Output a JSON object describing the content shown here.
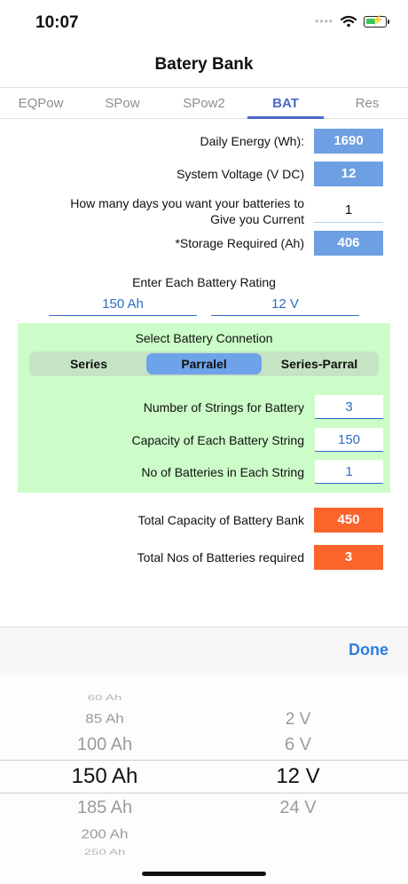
{
  "status": {
    "time": "10:07",
    "battery_level": 0.55,
    "signal_dots": "••••"
  },
  "nav": {
    "title": "Batery Bank"
  },
  "tabs": [
    {
      "label": "EQPow"
    },
    {
      "label": "SPow"
    },
    {
      "label": "SPow2"
    },
    {
      "label": "BAT"
    },
    {
      "label": "Res"
    }
  ],
  "form": {
    "daily_energy_label": "Daily Energy (Wh):",
    "daily_energy_value": "1690",
    "system_voltage_label": "System Voltage (V DC)",
    "system_voltage_value": "12",
    "days_label_line1": "How many days you want your batteries to",
    "days_label_line2": "Give you Current",
    "days_value": "1",
    "storage_label": "*Storage Required (Ah)",
    "storage_value": "406"
  },
  "rating": {
    "label": "Enter Each Battery Rating",
    "ah_value": "150 Ah",
    "volt_value": "12 V"
  },
  "connection": {
    "label": "Select Battery Connetion",
    "options": [
      "Series",
      "Parralel",
      "Series-Parral"
    ],
    "selected": "Parralel",
    "strings_label": "Number of Strings for Battery",
    "strings_value": "3",
    "capacity_label": "Capacity of Each Battery String",
    "capacity_value": "150",
    "per_string_label": "No of Batteries in Each String",
    "per_string_value": "1"
  },
  "results": {
    "total_capacity_label": "Total Capacity of Battery Bank",
    "total_capacity_value": "450",
    "total_batteries_label": "Total Nos of Batteries required",
    "total_batteries_value": "3"
  },
  "toolbar": {
    "done_label": "Done"
  },
  "picker": {
    "ah": {
      "above": [
        "60 Ah",
        "85 Ah",
        "100 Ah"
      ],
      "selected": "150 Ah",
      "below": [
        "185 Ah",
        "200 Ah",
        "250 Ah"
      ]
    },
    "volt": {
      "above": [
        "2 V",
        "6 V"
      ],
      "selected": "12 V",
      "below": [
        "24 V"
      ]
    }
  },
  "colors": {
    "accent": "#4a69c8",
    "value_blue": "#6e9fe2",
    "result_orange": "#fb642a",
    "panel_green": "#ccfcc7",
    "done_blue": "#2f7ee0"
  }
}
